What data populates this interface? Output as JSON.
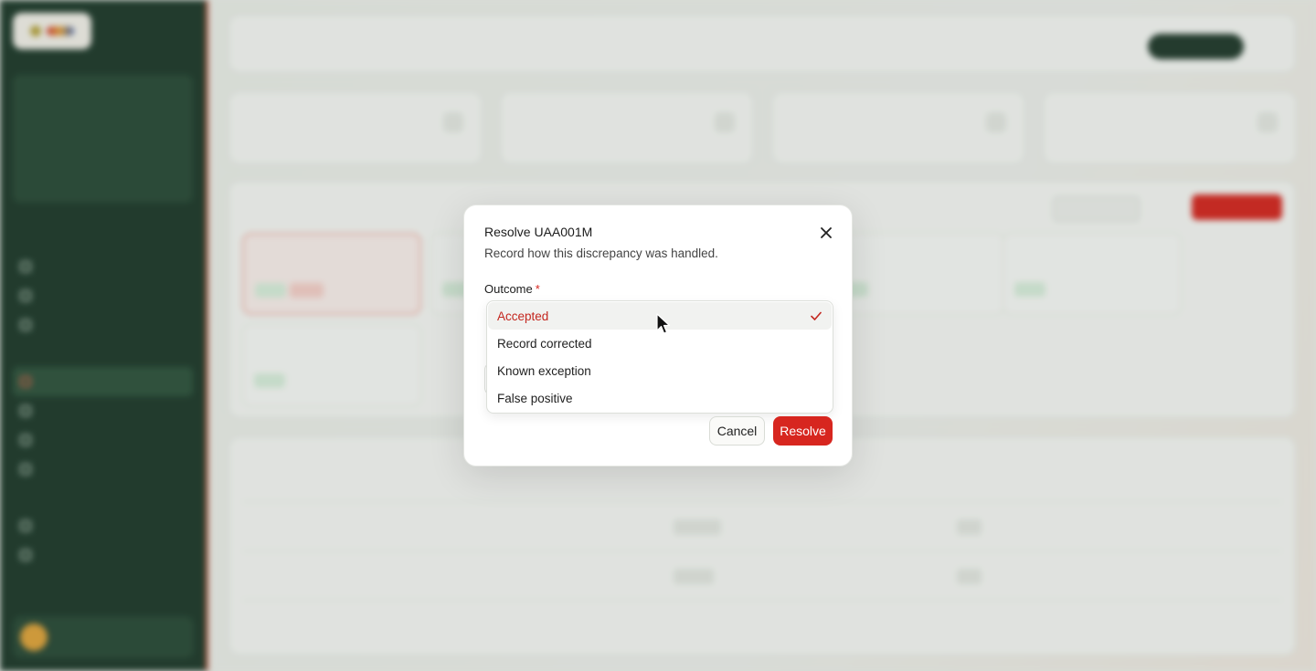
{
  "modal": {
    "title": "Resolve UAA001M",
    "description": "Record how this discrepancy was handled.",
    "outcome_label": "Outcome",
    "required_mark": "*",
    "options": [
      {
        "label": "Accepted",
        "selected": true
      },
      {
        "label": "Record corrected",
        "selected": false
      },
      {
        "label": "Known exception",
        "selected": false
      },
      {
        "label": "False positive",
        "selected": false
      }
    ],
    "cancel_label": "Cancel",
    "resolve_label": "Resolve"
  },
  "icons": {
    "close": "close-icon",
    "check": "check-icon",
    "cursor": "mouse-pointer-icon"
  },
  "colors": {
    "accent_red": "#d7261f",
    "sidebar_green": "#1f3a2b",
    "selected_option_text": "#c4271f"
  }
}
